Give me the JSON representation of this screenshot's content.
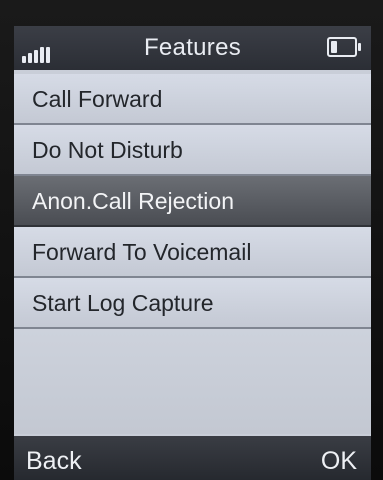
{
  "statusbar": {
    "title": "Features",
    "signal_icon": "signal-strength-icon",
    "battery_icon": "battery-icon"
  },
  "menu": {
    "items": [
      {
        "label": "Call Forward",
        "selected": false
      },
      {
        "label": "Do Not Disturb",
        "selected": false
      },
      {
        "label": "Anon.Call Rejection",
        "selected": true
      },
      {
        "label": "Forward To Voicemail",
        "selected": false
      },
      {
        "label": "Start Log Capture",
        "selected": false
      }
    ]
  },
  "softkeys": {
    "left": "Back",
    "right": "OK"
  },
  "colors": {
    "statusbar": "#2f323a",
    "menu_bg": "#ccd1db",
    "selected_bg": "#55585e",
    "text": "#23262b"
  }
}
